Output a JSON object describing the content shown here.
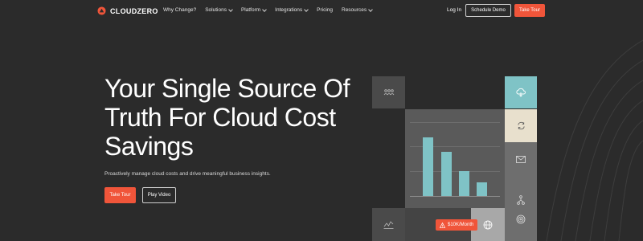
{
  "brand": {
    "name": "CLOUDZERO",
    "accent": "#f0553a",
    "teal": "#7fc3c6"
  },
  "nav": {
    "items": [
      {
        "label": "Why Change?",
        "dropdown": false
      },
      {
        "label": "Solutions",
        "dropdown": true
      },
      {
        "label": "Platform",
        "dropdown": true
      },
      {
        "label": "Integrations",
        "dropdown": true
      },
      {
        "label": "Pricing",
        "dropdown": false
      },
      {
        "label": "Resources",
        "dropdown": true
      }
    ],
    "login": "Log In",
    "schedule_demo": "Schedule Demo",
    "take_tour": "Take Tour"
  },
  "hero": {
    "headline": "Your Single Source Of Truth For Cloud Cost Savings",
    "subtext": "Proactively manage cloud costs and drive meaningful business insights.",
    "primary_button": "Take Tour",
    "secondary_button": "Play Video"
  },
  "illustration": {
    "badge": "$10K/Month",
    "bar_values": [
      0.73,
      0.55,
      0.31,
      0.17
    ],
    "icons": [
      "people-icon",
      "cloud-icon",
      "refresh-icon",
      "mail-icon",
      "network-icon",
      "chart-icon",
      "globe-icon",
      "target-icon",
      "warning-icon"
    ]
  }
}
